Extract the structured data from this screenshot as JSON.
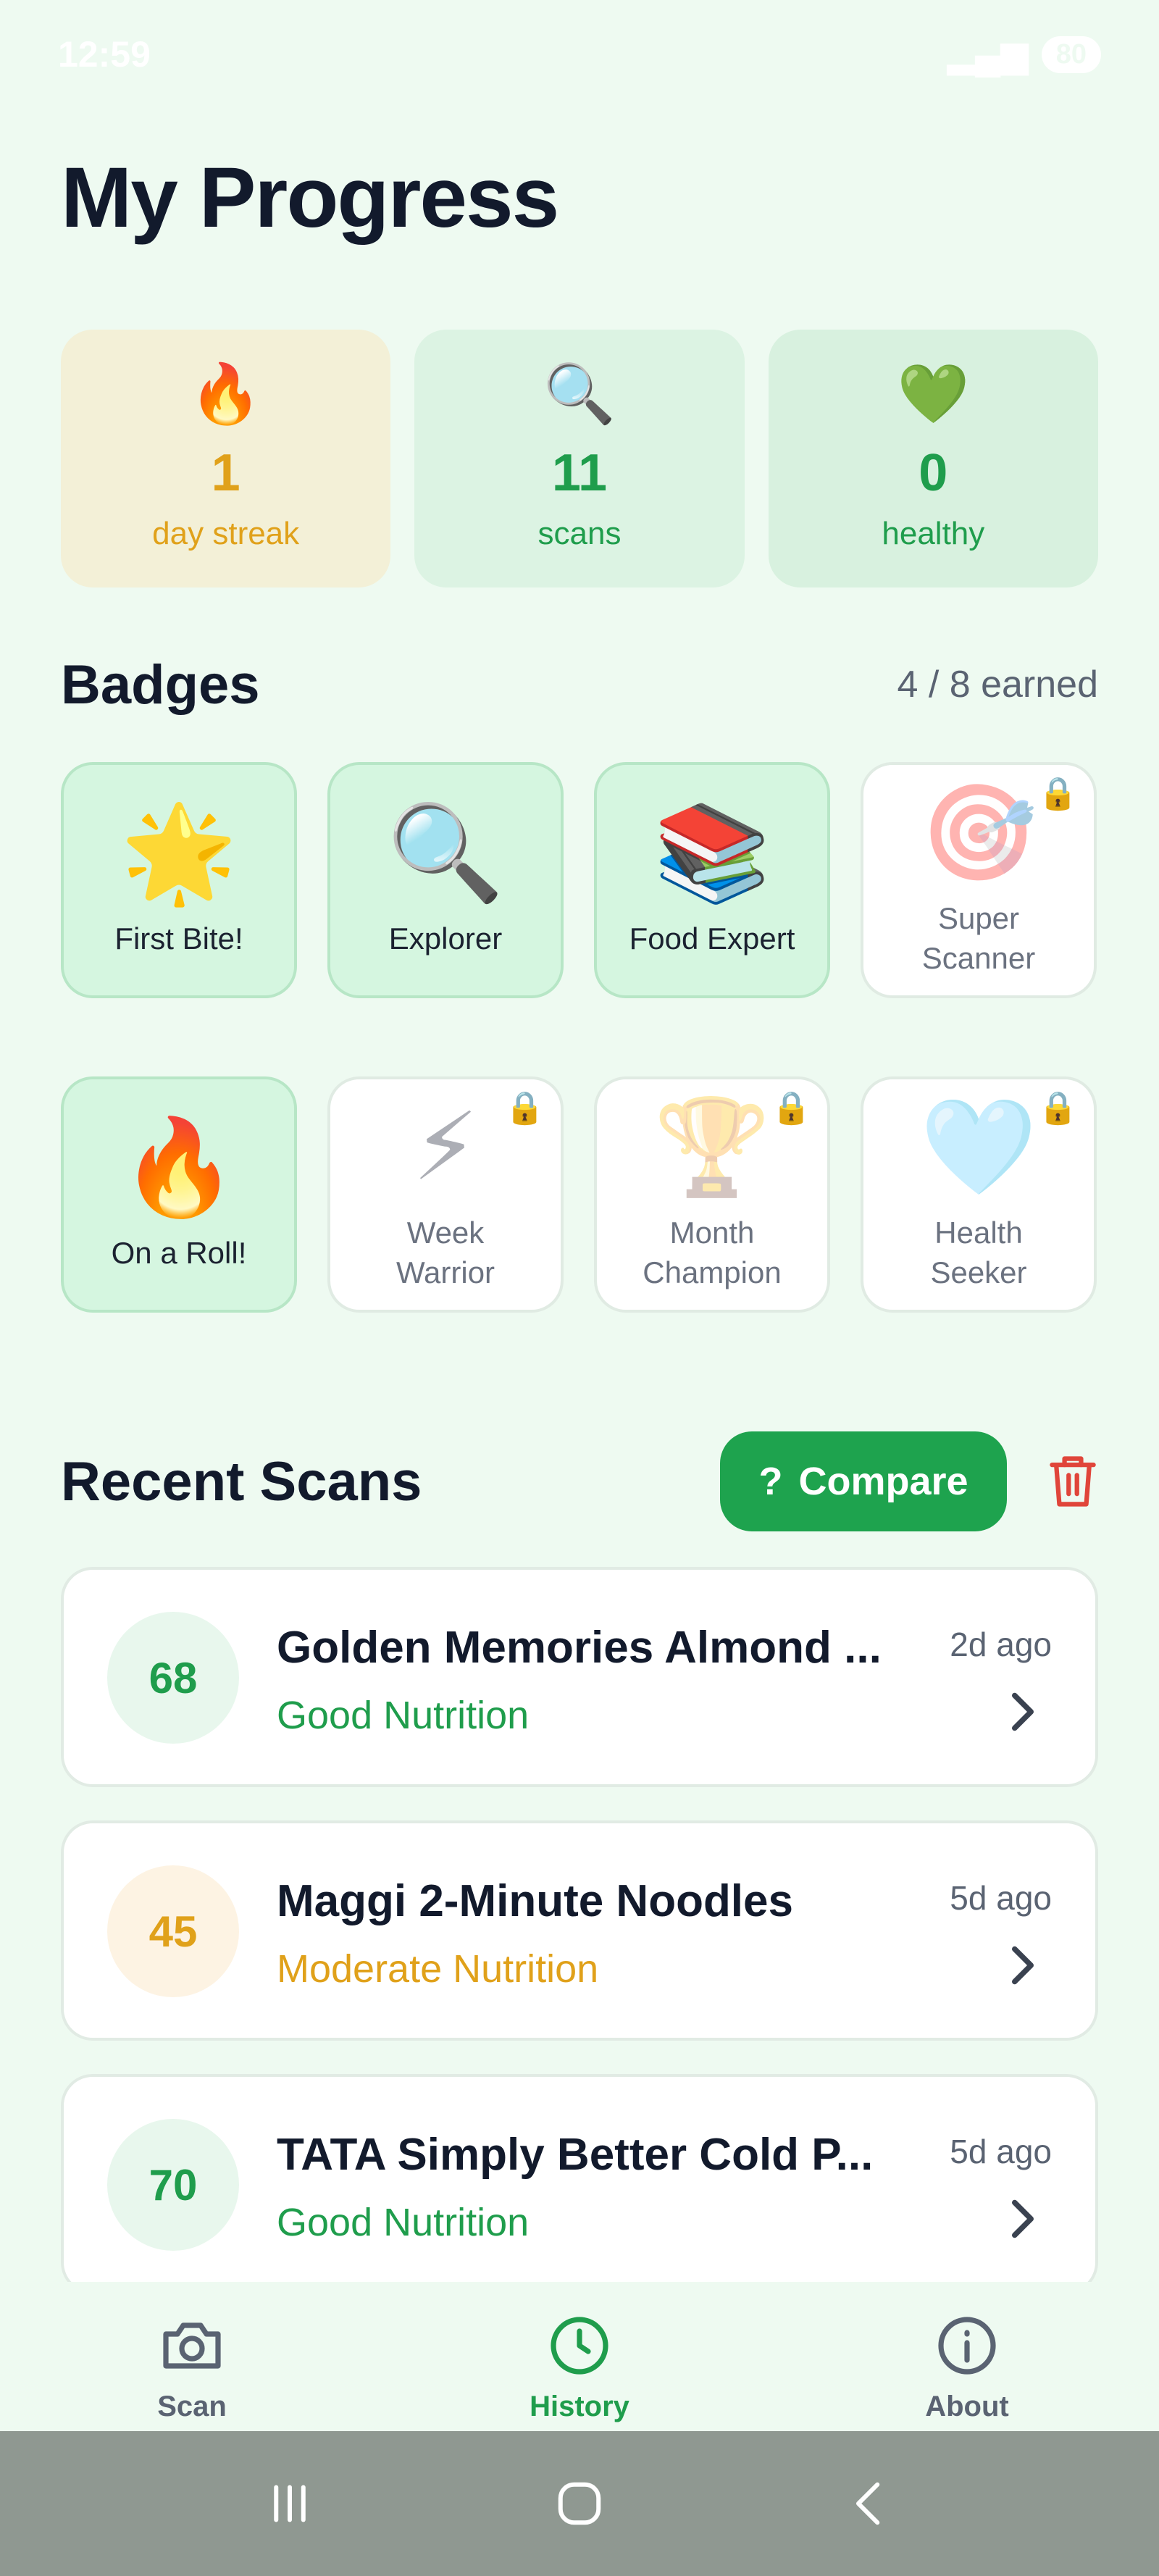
{
  "status_bar": {
    "time": "12:59",
    "battery": "80"
  },
  "page": {
    "title": "My Progress"
  },
  "stats": [
    {
      "icon": "🔥",
      "icon_name": "fire-icon",
      "value": "1",
      "label": "day streak"
    },
    {
      "icon": "🔍",
      "icon_name": "magnifier-icon",
      "value": "11",
      "label": "scans"
    },
    {
      "icon": "💚",
      "icon_name": "green-heart-icon",
      "value": "0",
      "label": "healthy"
    }
  ],
  "badges": {
    "title": "Badges",
    "earned_count": "4 / 8 earned",
    "items": [
      {
        "icon": "🌟",
        "icon_name": "glowing-star-icon",
        "label": "First Bite!",
        "earned": true
      },
      {
        "icon": "🔍",
        "icon_name": "magnifier-icon",
        "label": "Explorer",
        "earned": true
      },
      {
        "icon": "📚",
        "icon_name": "books-icon",
        "label": "Food Expert",
        "earned": true
      },
      {
        "icon": "🎯",
        "icon_name": "target-icon",
        "label": "Super Scanner",
        "earned": false
      },
      {
        "icon": "🔥",
        "icon_name": "fire-icon",
        "label": "On a Roll!",
        "earned": true
      },
      {
        "icon": "⚡",
        "icon_name": "lightning-icon",
        "label": "Week Warrior",
        "earned": false
      },
      {
        "icon": "🏆",
        "icon_name": "trophy-icon",
        "label": "Month Champion",
        "earned": false
      },
      {
        "icon": "🩵",
        "icon_name": "heart-icon",
        "label": "Health Seeker",
        "earned": false
      }
    ]
  },
  "recent": {
    "title": "Recent Scans",
    "compare_label": "Compare",
    "compare_icon": "?",
    "items": [
      {
        "score": "68",
        "name": "Golden Memories Almond ...",
        "rating": "Good Nutrition",
        "time": "2d ago",
        "level": "good"
      },
      {
        "score": "45",
        "name": "Maggi 2-Minute Noodles",
        "rating": "Moderate Nutrition",
        "time": "5d ago",
        "level": "moderate"
      },
      {
        "score": "70",
        "name": "TATA Simply Better Cold P...",
        "rating": "Good Nutrition",
        "time": "5d ago",
        "level": "good"
      }
    ]
  },
  "bottom_nav": [
    {
      "label": "Scan",
      "icon_name": "camera-icon",
      "active": false
    },
    {
      "label": "History",
      "icon_name": "clock-icon",
      "active": true
    },
    {
      "label": "About",
      "icon_name": "info-icon",
      "active": false
    }
  ],
  "colors": {
    "accent_green": "#1ea34e",
    "moderate_orange": "#e0a11a",
    "delete_red": "#e0453a",
    "background": "#eefaf1"
  }
}
